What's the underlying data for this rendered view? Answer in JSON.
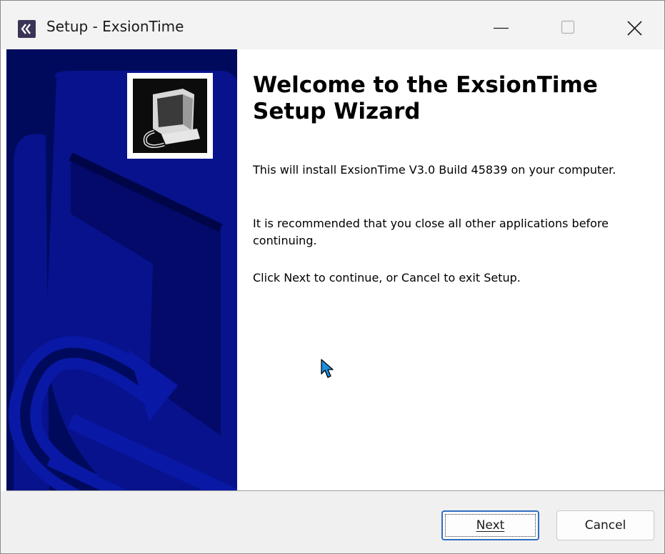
{
  "window": {
    "title": "Setup - ExsionTime",
    "controls": [
      "minimize-icon",
      "maximize-icon",
      "close-icon"
    ]
  },
  "banner": {
    "background_color": "#000a5c",
    "logo_icon": "computer-install-icon"
  },
  "content": {
    "heading": "Welcome to the ExsionTime Setup Wizard",
    "paragraph_1": "This will install ExsionTime V3.0 Build 45839 on your computer.",
    "paragraph_2": "It is recommended that you close all other applications before continuing.",
    "paragraph_3": "Click Next to continue, or Cancel to exit Setup."
  },
  "footer": {
    "next_label": "Next",
    "cancel_label": "Cancel"
  },
  "colors": {
    "accent": "#2f6ec0",
    "titlebar": "#f3f3f3",
    "footer": "#f0f0f0"
  }
}
